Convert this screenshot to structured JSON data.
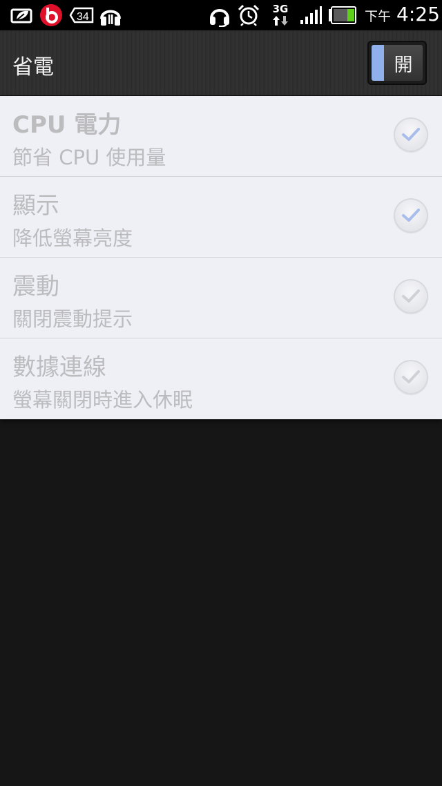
{
  "status_bar": {
    "time_prefix": "下午",
    "time": "4:25",
    "network_type": "3G",
    "notification_count": "34",
    "icons": [
      "eco-icon",
      "beats-icon",
      "notification-count-icon",
      "headphones-app-icon",
      "headset-icon",
      "alarm-icon",
      "network-3g-icon",
      "signal-icon",
      "battery-icon"
    ]
  },
  "action_bar": {
    "title": "省電",
    "toggle_label": "開",
    "toggle_accent": "#8fb0ea"
  },
  "settings": [
    {
      "title": "CPU 電力",
      "subtitle": "節省 CPU 使用量",
      "checked": true
    },
    {
      "title": "顯示",
      "subtitle": "降低螢幕亮度",
      "checked": true
    },
    {
      "title": "震動",
      "subtitle": "關閉震動提示",
      "checked": false
    },
    {
      "title": "數據連線",
      "subtitle": "螢幕關閉時進入休眠",
      "checked": false
    }
  ],
  "colors": {
    "checked_mark": "#a9bdea",
    "unchecked_mark": "#d0d1d6"
  }
}
